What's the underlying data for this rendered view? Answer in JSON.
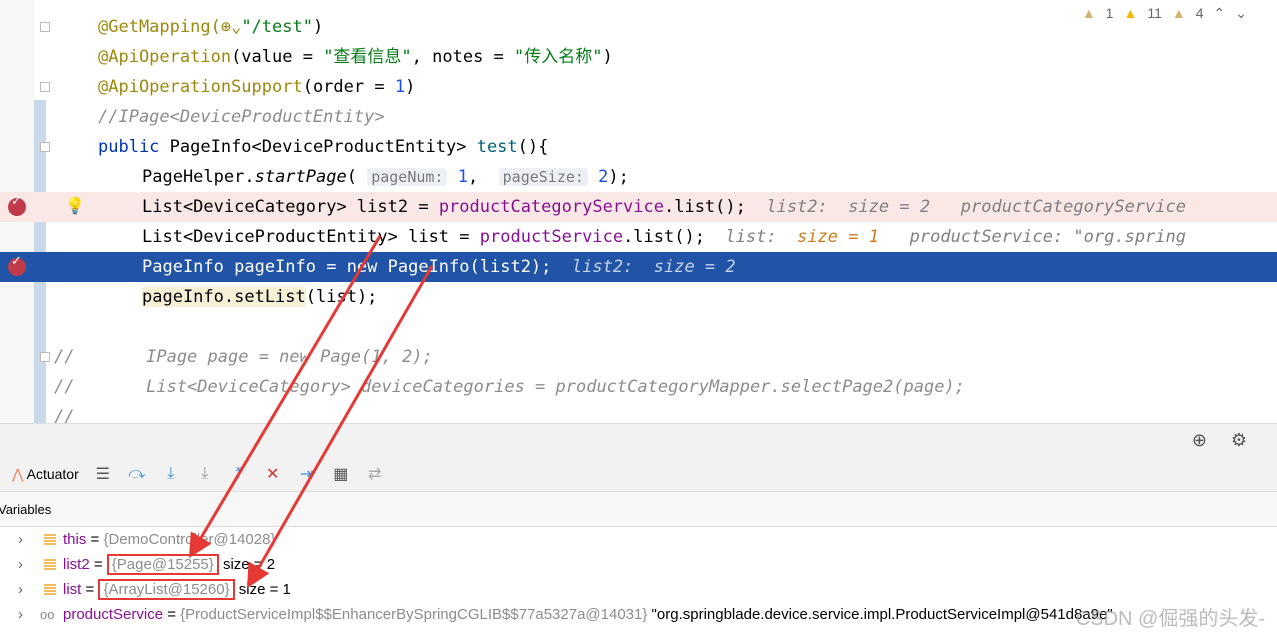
{
  "editor": {
    "lines": [
      [
        {
          "c": "ann",
          "t": "@GetMapping("
        },
        {
          "c": "ann",
          "t": "⊕⌄"
        },
        {
          "c": "str",
          "t": "\"/test\""
        },
        {
          "c": "",
          "t": ")"
        }
      ],
      [
        {
          "c": "ann",
          "t": "@ApiOperation"
        },
        {
          "c": "",
          "t": "(value = "
        },
        {
          "c": "str",
          "t": "\"查看信息\""
        },
        {
          "c": "",
          "t": ", notes = "
        },
        {
          "c": "str",
          "t": "\"传入名称\""
        },
        {
          "c": "",
          "t": ")"
        }
      ],
      [
        {
          "c": "ann",
          "t": "@ApiOperationSupport"
        },
        {
          "c": "",
          "t": "(order = "
        },
        {
          "c": "num",
          "t": "1"
        },
        {
          "c": "",
          "t": ")"
        }
      ],
      [
        {
          "c": "cm",
          "t": "//IPage<DeviceProductEntity>"
        }
      ],
      [
        {
          "c": "kw",
          "t": "public "
        },
        {
          "c": "",
          "t": "PageInfo<DeviceProductEntity> "
        },
        {
          "c": "fn",
          "t": "test"
        },
        {
          "c": "",
          "t": "(){"
        }
      ],
      [
        {
          "c": "",
          "t": "PageHelper."
        },
        {
          "c": "it",
          "t": "startPage"
        },
        {
          "c": "",
          "t": "( "
        },
        {
          "c": "param",
          "t": "pageNum:"
        },
        {
          "c": "num",
          "t": " 1"
        },
        {
          "c": "",
          "t": ",  "
        },
        {
          "c": "param",
          "t": "pageSize:"
        },
        {
          "c": "num",
          "t": " 2"
        },
        {
          "c": "",
          "t": ");"
        }
      ],
      [
        {
          "c": "",
          "t": "List<DeviceCategory> list2 = "
        },
        {
          "c": "field",
          "t": "productCategoryService"
        },
        {
          "c": "",
          "t": ".list();  "
        },
        {
          "c": "hint",
          "t": "list2:  size = 2   productCategoryService"
        }
      ],
      [
        {
          "c": "",
          "t": "List<DeviceProductEntity> list = "
        },
        {
          "c": "field",
          "t": "productService"
        },
        {
          "c": "",
          "t": ".list();  "
        },
        {
          "c": "hint",
          "t": "list:  "
        },
        {
          "c": "hint-o",
          "t": "size = 1"
        },
        {
          "c": "hint",
          "t": "   productService: \"org.spring"
        }
      ],
      [
        {
          "c": "",
          "t": "PageInfo pageInfo = new PageInfo(list2);  "
        },
        {
          "c": "hint",
          "t": "list2:  size = 2"
        }
      ],
      [
        {
          "c": "hl",
          "t": "pageInfo.setList"
        },
        {
          "c": "",
          "t": "(list);"
        }
      ],
      [],
      [
        {
          "c": "cm",
          "t": "//       IPage page = new Page(1, 2);"
        }
      ],
      [
        {
          "c": "cm",
          "t": "//       List<DeviceCategory> deviceCategories = productCategoryMapper.selectPage2(page);"
        }
      ],
      [
        {
          "c": "cm",
          "t": "//"
        }
      ]
    ],
    "inspections": {
      "weak": "1",
      "warnings": "11",
      "typos": "4"
    }
  },
  "debugger": {
    "actuator_label": "Actuator",
    "variables_label": "Variables",
    "variables": [
      {
        "name": "this",
        "ref": "{DemoController@14028}",
        "extra": ""
      },
      {
        "name": "list2",
        "ref": "{Page@15255}",
        "extra": " size = 2"
      },
      {
        "name": "list",
        "ref": "{ArrayList@15260}",
        "extra": " size = 1"
      },
      {
        "name": "productService",
        "ref": "{ProductServiceImpl$$EnhancerBySpringCGLIB$$77a5327a@14031}",
        "extra": " \"org.springblade.device.service.impl.ProductServiceImpl@541d8a9e\""
      }
    ]
  },
  "watermark": "CSDN @倔强的头发-",
  "colors": {
    "execution_line": "#2154a6",
    "breakpoint_line": "#f9e8e6",
    "annotation_arrow": "#e53935"
  }
}
